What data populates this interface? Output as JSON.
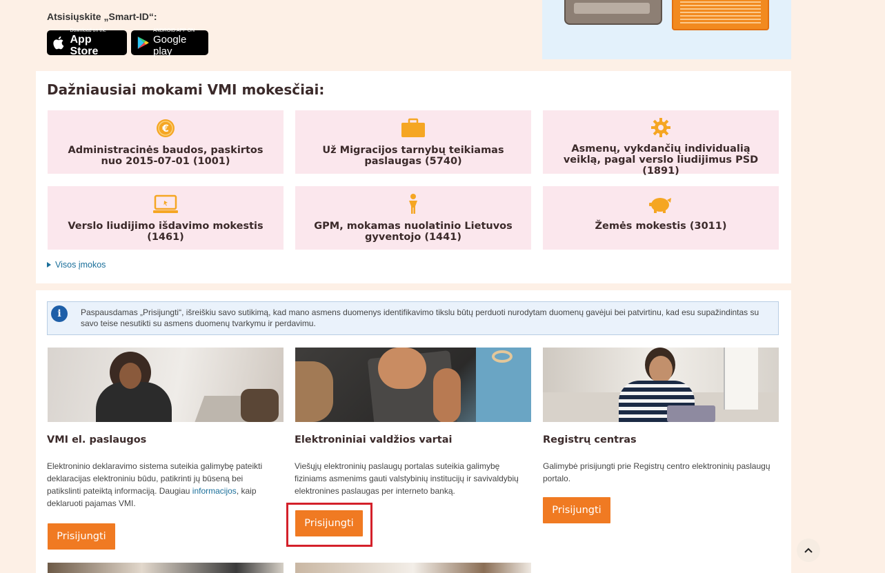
{
  "smartid": {
    "label": "Atsisiųskite „Smart-ID“:",
    "appstore": {
      "small": "Download on the",
      "big": "App Store"
    },
    "googleplay": {
      "small": "ANDROID APP ON",
      "big": "Google play"
    }
  },
  "taxes": {
    "title": "Dažniausiai mokami VMI mokesčiai:",
    "items": [
      {
        "label": "Administracinės baudos, paskirtos nuo 2015-07-01 (1001)",
        "icon": "euro-coin-icon"
      },
      {
        "label": "Už Migracijos tarnybų teikiamas paslaugas (5740)",
        "icon": "briefcase-icon"
      },
      {
        "label": "Asmenų, vykdančių individualią veiklą, pagal verslo liudijimus PSD (1891)",
        "icon": "gear-icon"
      },
      {
        "label": "Verslo liudijimo išdavimo mokestis (1461)",
        "icon": "laptop-icon"
      },
      {
        "label": "GPM, mokamas nuolatinio Lietuvos gyventojo (1441)",
        "icon": "person-icon"
      },
      {
        "label": "Žemės mokestis (3011)",
        "icon": "piggy-bank-icon"
      }
    ],
    "all_link": "Visos įmokos"
  },
  "notice": {
    "text": "Paspausdamas „Prisijungti“, išreiškiu savo sutikimą, kad mano asmens duomenys identifikavimo tikslu būtų perduoti nurodytam duomenų gavėjui bei patvirtinu, kad esu supažindintas su savo teise nesutikti su asmens duomenų tvarkymu ir perdavimu."
  },
  "services": [
    {
      "title": "VMI el. paslaugos",
      "desc_before": "Elektroninio deklaravimo sistema suteikia galimybę pateikti deklaracijas elektroniniu būdu, patikrinti jų būseną bei patikslinti pateiktą informaciją. Daugiau ",
      "desc_link": "informacijos",
      "desc_after": ", kaip deklaruoti pajamas VMI.",
      "button": "Prisijungti"
    },
    {
      "title": "Elektroniniai valdžios vartai",
      "desc_before": "Viešųjų elektroninių paslaugų portalas suteikia galimybę fiziniams asmenims gauti valstybinių institucijų ir savivaldybių elektronines paslaugas per interneto banką.",
      "button": "Prisijungti"
    },
    {
      "title": "Registrų centras",
      "desc_before": "Galimybė prisijungti prie Registrų centro elektroninių paslaugų portalo.",
      "button": "Prisijungti"
    }
  ],
  "colors": {
    "accent": "#f07a22",
    "icon_orange": "#f5a623",
    "highlight": "#d4202a",
    "link": "#1a6f9a"
  }
}
